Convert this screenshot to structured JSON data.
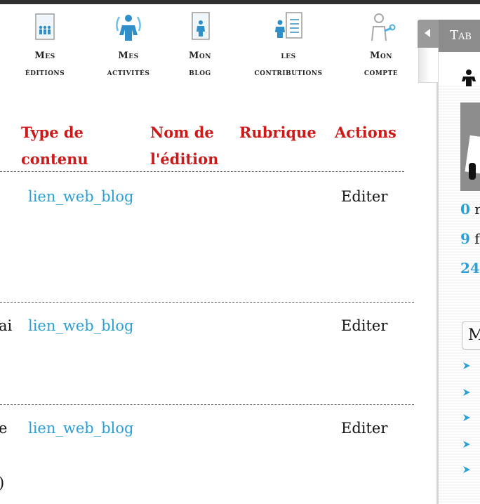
{
  "nav": [
    {
      "line1": "Mes",
      "line2": "éditions",
      "icon": "editions-icon"
    },
    {
      "line1": "Mes",
      "line2": "activités",
      "icon": "activities-icon"
    },
    {
      "line1": "Mon",
      "line2": "blog",
      "icon": "blog-icon"
    },
    {
      "line1": "les",
      "line2": "contributions",
      "icon": "contributions-icon"
    },
    {
      "line1": "Mon",
      "line2": "compte",
      "icon": "account-icon"
    }
  ],
  "table": {
    "headers": {
      "type": [
        "Type de",
        "contenu"
      ],
      "edition": [
        "Nom de",
        "l'édition"
      ],
      "rubrique": "Rubrique",
      "actions": "Actions"
    },
    "rows": [
      {
        "partial": "",
        "type": "lien_web_blog",
        "action": "Editer"
      },
      {
        "partial": "ai",
        "type": "lien_web_blog",
        "action": "Editer"
      },
      {
        "partial": "e",
        "type": "lien_web_blog",
        "action": "Editer"
      }
    ],
    "trailing_partial": ")"
  },
  "panel": {
    "title": "Tab",
    "stats": [
      {
        "num": "0",
        "rest": "r"
      },
      {
        "num": "9",
        "rest": "f"
      },
      {
        "num": "24",
        "rest": ""
      }
    ],
    "select_value": "M"
  },
  "colors": {
    "header_red": "#cc1a1a",
    "link_blue": "#2aa0d6",
    "panel_gray": "#8c8c8c"
  }
}
